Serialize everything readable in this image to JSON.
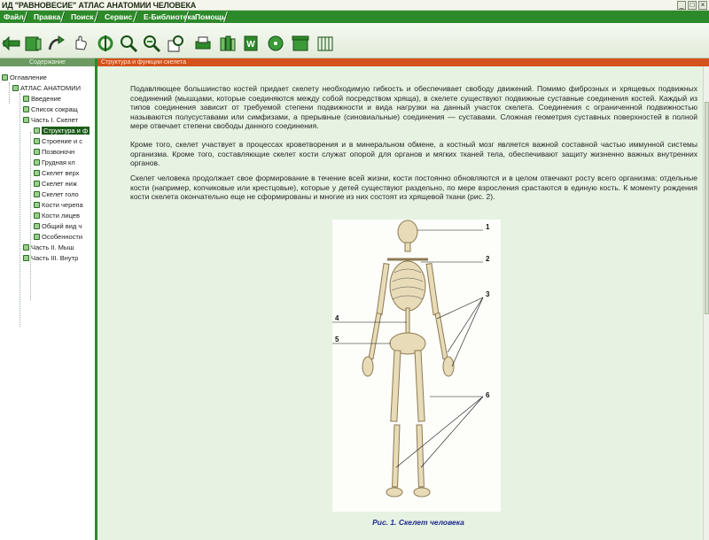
{
  "window": {
    "title": "ИД \"РАВНОВЕСИЕ\" АТЛАС АНАТОМИИ ЧЕЛОВЕКА",
    "controls": [
      "_",
      "□",
      "×"
    ]
  },
  "menu": [
    "Файл",
    "Правка",
    "Поиск",
    "Сервис",
    "Е-Библиотека",
    "Помощь"
  ],
  "toolbar": {
    "icons": [
      "back-arrow-icon",
      "book-icon",
      "forward-arrow-icon",
      "hand-pointer-icon",
      "anchor-icon",
      "zoom-in-icon",
      "zoom-search-icon",
      "zoom-page-icon",
      "print-icon",
      "books-icon",
      "word-icon",
      "cd-disc-icon",
      "archive-icon",
      "library-icon"
    ]
  },
  "left_panel": {
    "header": "Содержание",
    "tree": [
      {
        "label": "Оглавление",
        "level": 0
      },
      {
        "label": "АТЛАС АНАТОМИИ",
        "level": 1
      },
      {
        "label": "Введение",
        "level": 2
      },
      {
        "label": "Список сокращ",
        "level": 2
      },
      {
        "label": "Часть I. Скелет",
        "level": 2
      },
      {
        "label": "Структура и ф",
        "level": 3,
        "selected": true
      },
      {
        "label": "Строение и с",
        "level": 3
      },
      {
        "label": "Позвоночн",
        "level": 3
      },
      {
        "label": "Грудная кл",
        "level": 3
      },
      {
        "label": "Скелет верх",
        "level": 3
      },
      {
        "label": "Скелет ниж",
        "level": 3
      },
      {
        "label": "Скелет голо",
        "level": 3
      },
      {
        "label": "Кости черепа",
        "level": 3
      },
      {
        "label": "Кости лицев",
        "level": 3
      },
      {
        "label": "Общий вид ч",
        "level": 3
      },
      {
        "label": "Особенности",
        "level": 3
      },
      {
        "label": "Часть II. Мыш",
        "level": 2
      },
      {
        "label": "Часть III. Внутр",
        "level": 2
      }
    ]
  },
  "content": {
    "header": "Структура и функции скелета",
    "paragraphs": [
      "Подавляющее большинство костей придает скелету необходимую гибкость и обеспечивает свободу движений. Помимо фиброзных и хрящевых подвижных соединений (мышцами, которые соединяются между собой посредством хряща), в скелете существуют подвижные суставные соединения костей. Каждый из типов соединения зависит от требуемой степени подвижности и вида нагрузки на данный участок скелета. Соединения с ограниченной подвижностью называются полусуставами или симфизами, а прерывные (синовиальные) соединения — суставами. Сложная геометрия суставных поверхностей в полной мере отвечает степени свободы данного соединения.",
      "Кроме того, скелет участвует в процессах кроветворения и в минеральном обмене, а костный мозг является важной составной частью иммунной системы организма. Кроме того, составляющие скелет кости служат опорой для органов и мягких тканей тела, обеспечивают защиту жизненно важных внутренних органов.",
      "Скелет человека продолжает свое формирование в течение всей жизни, кости постоянно обновляются и в целом отвечают росту всего организма: отдельные кости (например, копчиковые или крестцовые), которые у детей существуют раздельно, по мере взросления срастаются в единую кость. К моменту рождения кости скелета окончательно еще не сформированы и многие из них состоят из хрящевой ткани (рис. 2)."
    ],
    "figure": {
      "labels": [
        "1",
        "2",
        "3",
        "4",
        "5",
        "6"
      ],
      "caption": "Рис. 1. Скелет человека"
    }
  },
  "colors": {
    "menubar": "#2d8a2a",
    "content_header": "#d4521c",
    "page_background": "#e6f2e2",
    "caption_text": "#1e2a8c",
    "tree_selected": "#1c5c1a"
  }
}
